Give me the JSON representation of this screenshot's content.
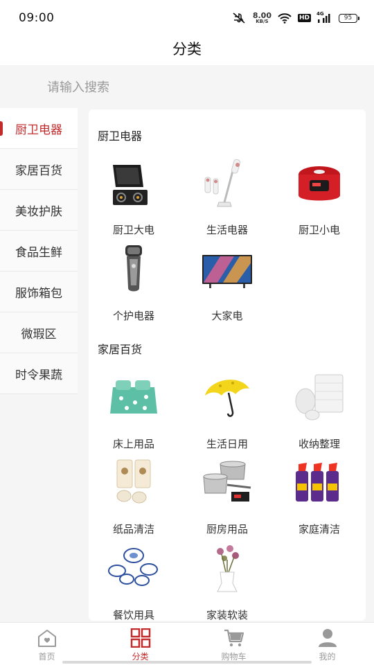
{
  "status_bar": {
    "time": "09:00",
    "network_speed": "8.00",
    "network_speed_unit": "KB/S",
    "hd_label": "HD",
    "cell_label": "4G",
    "battery": "95"
  },
  "header": {
    "title": "分类"
  },
  "search": {
    "placeholder": "请输入搜索"
  },
  "sidebar": {
    "items": [
      {
        "label": "厨卫电器",
        "active": true
      },
      {
        "label": "家居百货",
        "active": false
      },
      {
        "label": "美妆护肤",
        "active": false
      },
      {
        "label": "食品生鲜",
        "active": false
      },
      {
        "label": "服饰箱包",
        "active": false
      },
      {
        "label": "微瑕区",
        "active": false
      },
      {
        "label": "时令果蔬",
        "active": false
      }
    ]
  },
  "sections": [
    {
      "title": "厨卫电器",
      "items": [
        {
          "label": "厨卫大电",
          "icon": "range-hood-stove-icon"
        },
        {
          "label": "生活电器",
          "icon": "vacuum-cleaner-icon"
        },
        {
          "label": "厨卫小电",
          "icon": "rice-cooker-icon"
        },
        {
          "label": "个护电器",
          "icon": "shaver-icon"
        },
        {
          "label": "大家电",
          "icon": "television-icon"
        }
      ]
    },
    {
      "title": "家居百货",
      "items": [
        {
          "label": "床上用品",
          "icon": "bedding-icon"
        },
        {
          "label": "生活日用",
          "icon": "umbrella-icon"
        },
        {
          "label": "收纳整理",
          "icon": "laundry-bag-icon"
        },
        {
          "label": "纸品清洁",
          "icon": "tissue-rolls-icon"
        },
        {
          "label": "厨房用品",
          "icon": "cookware-icon"
        },
        {
          "label": "家庭清洁",
          "icon": "cleaner-bottles-icon"
        },
        {
          "label": "餐饮用具",
          "icon": "tableware-icon"
        },
        {
          "label": "家装软装",
          "icon": "flower-vase-icon"
        }
      ]
    }
  ],
  "tab_bar": {
    "tabs": [
      {
        "label": "首页",
        "icon": "home-icon",
        "active": false
      },
      {
        "label": "分类",
        "icon": "category-grid-icon",
        "active": true
      },
      {
        "label": "购物车",
        "icon": "cart-icon",
        "active": false
      },
      {
        "label": "我的",
        "icon": "user-icon",
        "active": false
      }
    ]
  },
  "colors": {
    "accent": "#c22b2b",
    "inactive_tab": "#999999",
    "background": "#f5f5f5"
  }
}
